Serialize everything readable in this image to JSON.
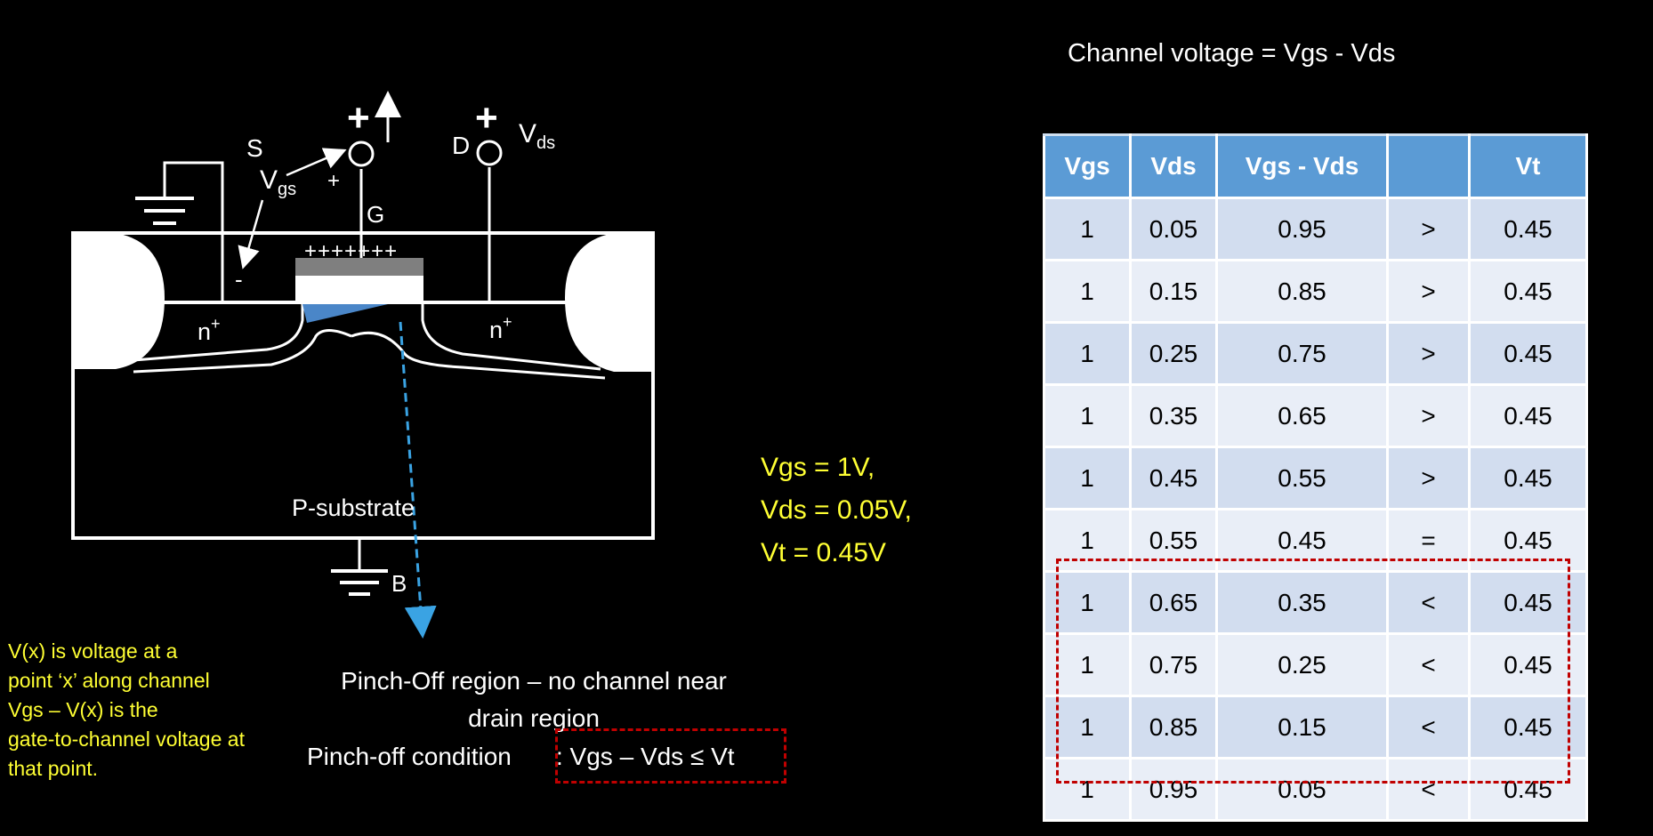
{
  "header": {
    "channel_voltage_title": "Channel voltage = Vgs - Vds"
  },
  "diagram": {
    "labels": {
      "source": "S",
      "drain": "D",
      "gate": "G",
      "body": "B",
      "vgs_main": "V",
      "vgs_sub": "gs",
      "vds_main": "V",
      "vds_sub": "ds",
      "plus_gate": "+",
      "plus_drain": "+",
      "plus_small": "+",
      "minus": "-",
      "gate_charges": "+++++++",
      "n_left": "n",
      "n_right": "n",
      "n_sup": "+",
      "substrate": "P-substrate"
    },
    "colors": {
      "channel": "#4a86c8",
      "arrow": "#3aa3e3",
      "gate_oxide": "#7f7f7f"
    }
  },
  "conditions": {
    "vgs": "Vgs = 1V,",
    "vds": "Vds = 0.05V,",
    "vt": "Vt = 0.45V"
  },
  "notes": {
    "line1": "V(x) is voltage at a",
    "line2": "point ‘x’ along channel",
    "line3": "Vgs – V(x) is the",
    "line4": "gate-to-channel voltage at",
    "line5": "that point."
  },
  "pinch": {
    "region_line1": "Pinch-Off region – no channel near",
    "region_line2": "drain region",
    "condition_label": "Pinch-off condition",
    "condition_expr": ": Vgs – Vds ≤ Vt"
  },
  "table": {
    "headers": [
      "Vgs",
      "Vds",
      "Vgs - Vds",
      "",
      "Vt"
    ],
    "rows": [
      [
        "1",
        "0.05",
        "0.95",
        ">",
        "0.45"
      ],
      [
        "1",
        "0.15",
        "0.85",
        ">",
        "0.45"
      ],
      [
        "1",
        "0.25",
        "0.75",
        ">",
        "0.45"
      ],
      [
        "1",
        "0.35",
        "0.65",
        ">",
        "0.45"
      ],
      [
        "1",
        "0.45",
        "0.55",
        ">",
        "0.45"
      ],
      [
        "1",
        "0.55",
        "0.45",
        "=",
        "0.45"
      ],
      [
        "1",
        "0.65",
        "0.35",
        "<",
        "0.45"
      ],
      [
        "1",
        "0.75",
        "0.25",
        "<",
        "0.45"
      ],
      [
        "1",
        "0.85",
        "0.15",
        "<",
        "0.45"
      ],
      [
        "1",
        "0.95",
        "0.05",
        "<",
        "0.45"
      ]
    ],
    "highlight_color": "#c00000"
  }
}
